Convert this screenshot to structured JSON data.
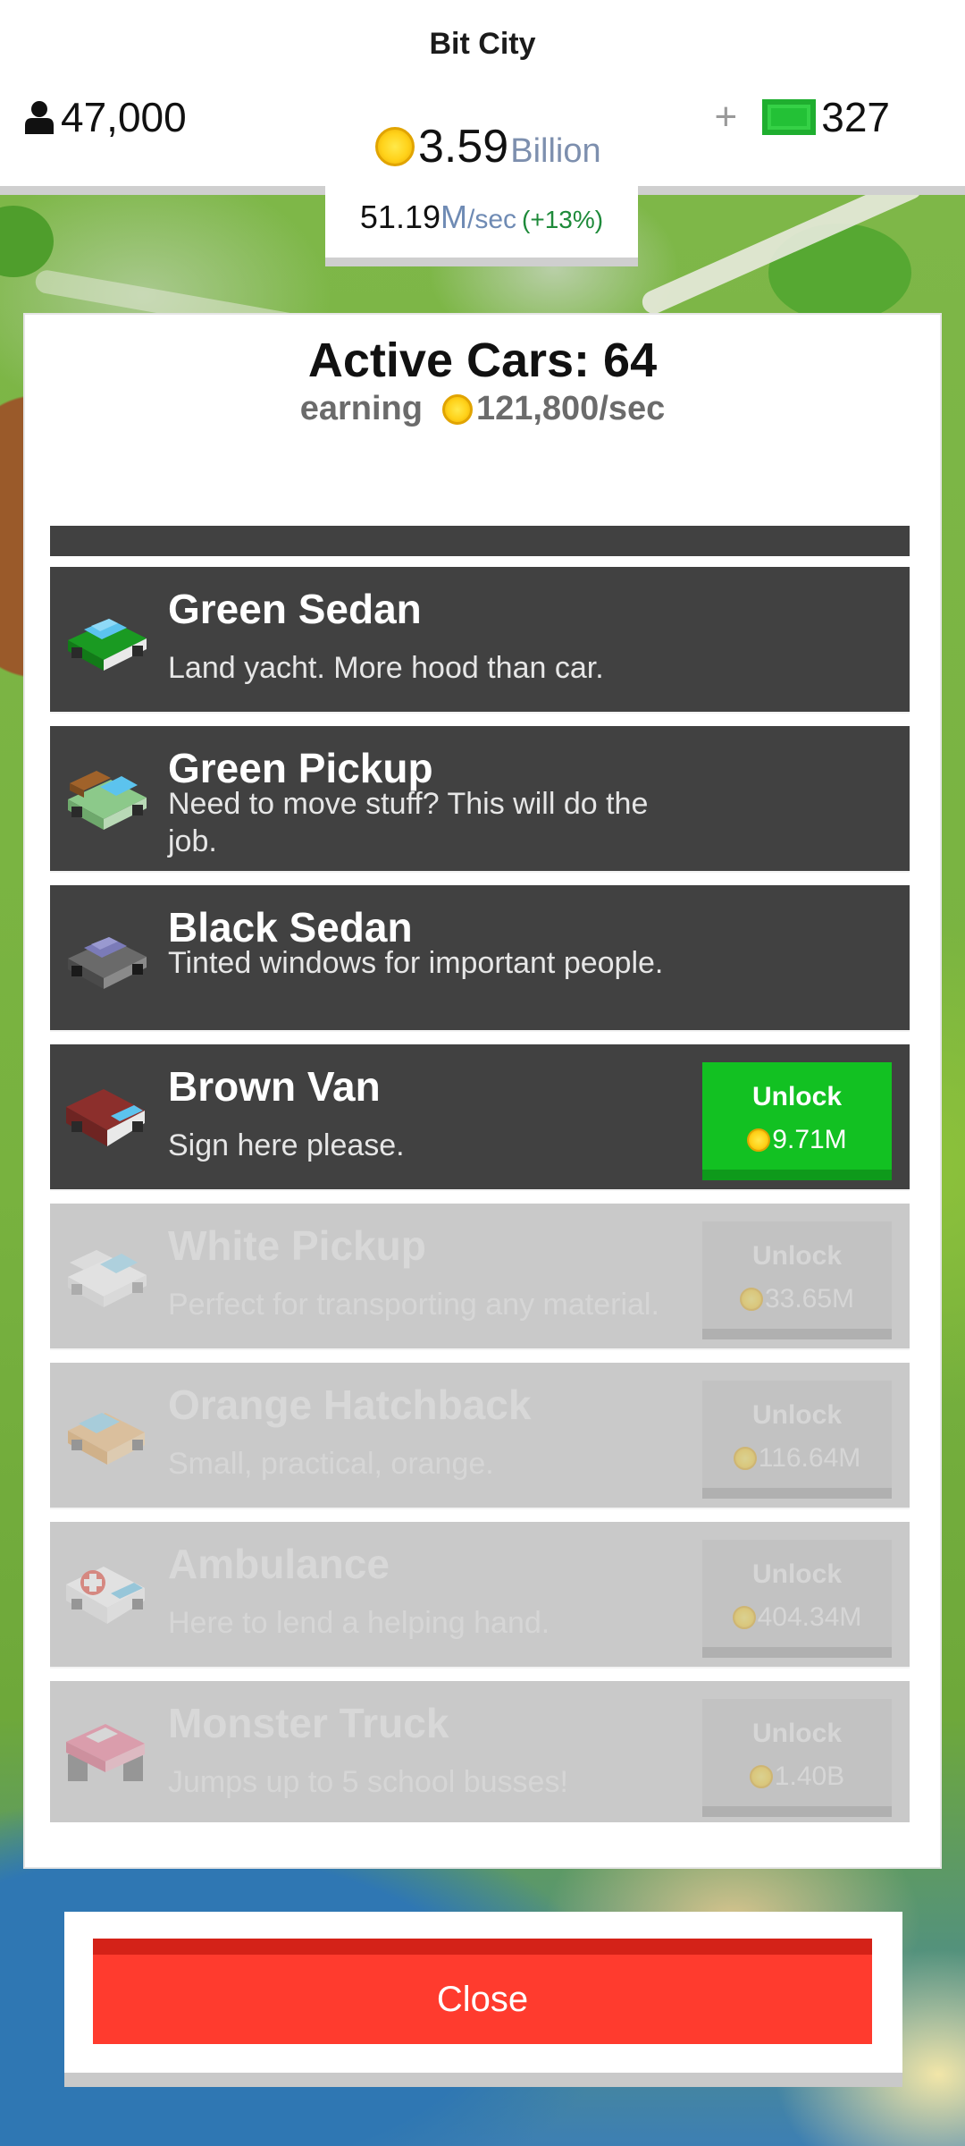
{
  "header": {
    "city_name": "Bit City",
    "population": "47,000",
    "money_amount": "3.59",
    "money_unit": "Billion",
    "gems_plus": "+",
    "gems_count": "327",
    "rate_value": "51.19",
    "rate_unit": "M",
    "rate_per": "/sec",
    "rate_bonus": "(+13%)"
  },
  "panel": {
    "title": "Active Cars: 64",
    "earning_label": "earning",
    "earning_value": "121,800/sec",
    "cars": [
      {
        "name": "Green Sedan",
        "desc": "Land yacht. More hood than car.",
        "state": "owned"
      },
      {
        "name": "Green Pickup",
        "desc": "Need to move stuff? This will do the job.",
        "state": "owned"
      },
      {
        "name": "Black Sedan",
        "desc": "Tinted windows for important people.",
        "state": "owned"
      },
      {
        "name": "Brown Van",
        "desc": "Sign here please.",
        "state": "available",
        "unlock_label": "Unlock",
        "price": "9.71M"
      },
      {
        "name": "White Pickup",
        "desc": "Perfect for transporting any material.",
        "state": "locked",
        "unlock_label": "Unlock",
        "price": "33.65M"
      },
      {
        "name": "Orange Hatchback",
        "desc": "Small, practical, orange.",
        "state": "locked",
        "unlock_label": "Unlock",
        "price": "116.64M"
      },
      {
        "name": "Ambulance",
        "desc": "Here to lend a helping hand.",
        "state": "locked",
        "unlock_label": "Unlock",
        "price": "404.34M"
      },
      {
        "name": "Monster Truck",
        "desc": "Jumps up to 5 school busses!",
        "state": "locked",
        "unlock_label": "Unlock",
        "price": "1.40B"
      }
    ]
  },
  "footer": {
    "close_label": "Close"
  },
  "colors": {
    "unlock_green": "#12c122",
    "close_red": "#ff3b2e",
    "row_dark": "#414141",
    "row_locked": "#c9c9c9"
  },
  "icons": {
    "population": "person-icon",
    "currency": "coin-icon",
    "premium": "cash-icon",
    "cars": [
      "green-sedan-icon",
      "green-pickup-icon",
      "black-sedan-icon",
      "brown-van-icon",
      "white-pickup-icon",
      "orange-hatchback-icon",
      "ambulance-icon",
      "monster-truck-icon"
    ]
  }
}
